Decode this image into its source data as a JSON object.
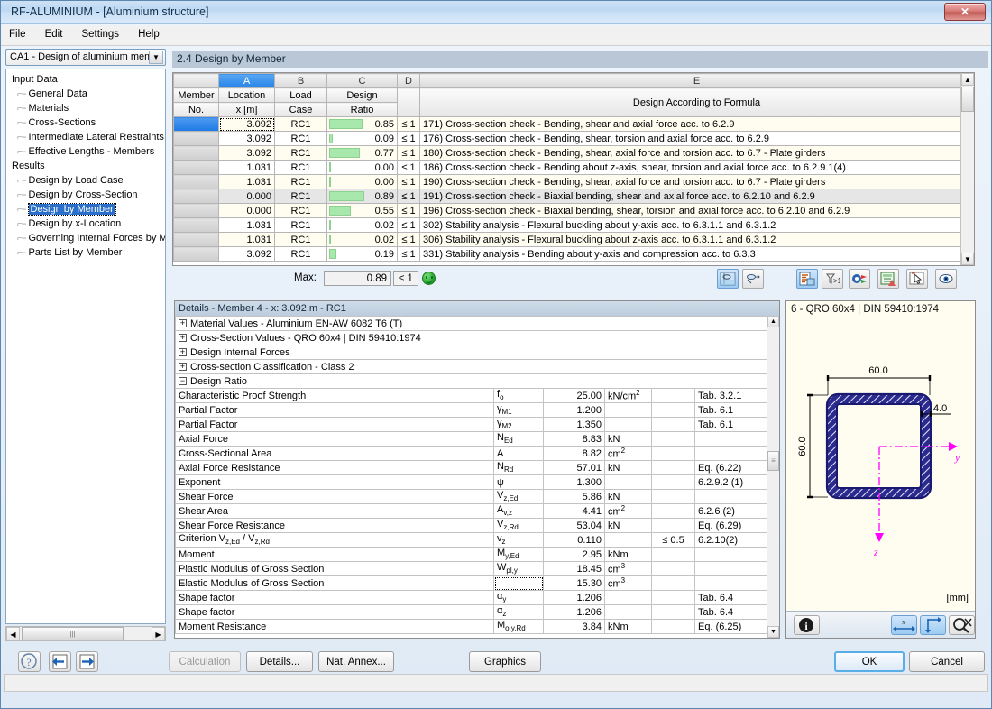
{
  "window": {
    "title": "RF-ALUMINIUM - [Aluminium structure]",
    "close_label": "✕"
  },
  "menu": {
    "items": [
      "File",
      "Edit",
      "Settings",
      "Help"
    ]
  },
  "sidebar": {
    "combo_value": "CA1 - Design of aluminium meml",
    "combo_arrow": "▼",
    "groups": [
      {
        "label": "Input Data",
        "items": [
          "General Data",
          "Materials",
          "Cross-Sections",
          "Intermediate Lateral Restraints",
          "Effective Lengths - Members"
        ]
      },
      {
        "label": "Results",
        "items": [
          "Design by Load Case",
          "Design by Cross-Section",
          "Design by Member",
          "Design by x-Location",
          "Governing Internal Forces by M",
          "Parts List by Member"
        ]
      }
    ],
    "selected": "Design by Member",
    "scroll": {
      "left_arrow": "◀",
      "right_arrow": "▶",
      "grip": "|||"
    }
  },
  "main": {
    "tab_title": "2.4 Design by Member",
    "grid": {
      "column_letters": [
        "A",
        "B",
        "C",
        "D",
        "E"
      ],
      "active_letter": "A",
      "headers": {
        "member": [
          "Member",
          "No."
        ],
        "location": [
          "Location",
          "x [m]"
        ],
        "loadcase": [
          "Load",
          "Case"
        ],
        "ratio": [
          "Design",
          "Ratio"
        ],
        "limit": "",
        "formula": "Design According to Formula"
      },
      "rows": [
        {
          "member": "",
          "location": "3.092",
          "load_case": "RC1",
          "ratio": "0.85",
          "bar": 0.85,
          "limit": "≤ 1",
          "formula": "171) Cross-section check - Bending, shear and axial force acc. to 6.2.9"
        },
        {
          "member": "",
          "location": "3.092",
          "load_case": "RC1",
          "ratio": "0.09",
          "bar": 0.09,
          "limit": "≤ 1",
          "formula": "176) Cross-section check - Bending, shear, torsion and axial force acc. to 6.2.9"
        },
        {
          "member": "",
          "location": "3.092",
          "load_case": "RC1",
          "ratio": "0.77",
          "bar": 0.77,
          "limit": "≤ 1",
          "formula": "180) Cross-section check - Bending, shear, axial force and torsion acc. to 6.7 - Plate girders"
        },
        {
          "member": "",
          "location": "1.031",
          "load_case": "RC1",
          "ratio": "0.00",
          "bar": 0.0,
          "limit": "≤ 1",
          "formula": "186) Cross-section check - Bending about z-axis, shear, torsion and axial force acc. to 6.2.9.1(4)"
        },
        {
          "member": "",
          "location": "1.031",
          "load_case": "RC1",
          "ratio": "0.00",
          "bar": 0.0,
          "limit": "≤ 1",
          "formula": "190) Cross-section check - Bending, shear, axial force and torsion acc. to 6.7 - Plate girders"
        },
        {
          "member": "",
          "location": "0.000",
          "load_case": "RC1",
          "ratio": "0.89",
          "bar": 0.89,
          "limit": "≤ 1",
          "formula": "191) Cross-section check - Biaxial bending, shear and axial force acc. to 6.2.10 and 6.2.9"
        },
        {
          "member": "",
          "location": "0.000",
          "load_case": "RC1",
          "ratio": "0.55",
          "bar": 0.55,
          "limit": "≤ 1",
          "formula": "196) Cross-section check - Biaxial bending, shear, torsion and axial force acc. to 6.2.10 and 6.2.9"
        },
        {
          "member": "",
          "location": "1.031",
          "load_case": "RC1",
          "ratio": "0.02",
          "bar": 0.02,
          "limit": "≤ 1",
          "formula": "302) Stability analysis - Flexural buckling about y-axis acc. to 6.3.1.1 and 6.3.1.2"
        },
        {
          "member": "",
          "location": "1.031",
          "load_case": "RC1",
          "ratio": "0.02",
          "bar": 0.02,
          "limit": "≤ 1",
          "formula": "306) Stability analysis - Flexural buckling about z-axis acc. to 6.3.1.1 and 6.3.1.2"
        },
        {
          "member": "",
          "location": "3.092",
          "load_case": "RC1",
          "ratio": "0.19",
          "bar": 0.19,
          "limit": "≤ 1",
          "formula": "331) Stability analysis - Bending about y-axis and compression acc. to 6.3.3"
        }
      ],
      "highlighted_row_index": 5,
      "selected_row_index": 0,
      "scroll": {
        "up": "▲",
        "down": "▼"
      }
    },
    "max": {
      "label": "Max:",
      "value": "0.89",
      "limit": "≤ 1",
      "status": "pass"
    },
    "toolbar": [
      {
        "name": "result-values-icon",
        "active": true
      },
      {
        "name": "result-diagram-icon",
        "active": false
      },
      {
        "name": "filter-list-icon",
        "active": true
      },
      {
        "name": "filter-greater-one-icon",
        "active": false
      },
      {
        "name": "color-render-icon",
        "active": false
      },
      {
        "name": "export-excel-icon",
        "active": false
      },
      {
        "name": "select-pointer-icon",
        "active": false
      },
      {
        "name": "view-eye-icon",
        "active": false
      }
    ]
  },
  "details": {
    "header": "Details - Member 4 - x: 3.092 m - RC1",
    "groups": [
      {
        "expander": "+",
        "label": "Material Values - Aluminium EN-AW 6082 T6 (T)"
      },
      {
        "expander": "+",
        "label": "Cross-Section Values  -  QRO 60x4 | DIN 59410:1974"
      },
      {
        "expander": "+",
        "label": "Design Internal Forces"
      },
      {
        "expander": "+",
        "label": "Cross-section Classification - Class 2"
      },
      {
        "expander": "−",
        "label": "Design Ratio"
      }
    ],
    "rows": [
      {
        "label": "Characteristic Proof Strength",
        "sym": "f",
        "sub": "o",
        "value": "25.00",
        "unit": "kN/cm",
        "unit_sup": "2",
        "limit": "",
        "ref": "Tab. 3.2.1"
      },
      {
        "label": "Partial Factor",
        "sym": "γ",
        "sub": "M1",
        "value": "1.200",
        "unit": "",
        "unit_sup": "",
        "limit": "",
        "ref": "Tab. 6.1"
      },
      {
        "label": "Partial Factor",
        "sym": "γ",
        "sub": "M2",
        "value": "1.350",
        "unit": "",
        "unit_sup": "",
        "limit": "",
        "ref": "Tab. 6.1"
      },
      {
        "label": "Axial Force",
        "sym": "N",
        "sub": "Ed",
        "value": "8.83",
        "unit": "kN",
        "unit_sup": "",
        "limit": "",
        "ref": ""
      },
      {
        "label": "Cross-Sectional Area",
        "sym": "A",
        "sub": "",
        "value": "8.82",
        "unit": "cm",
        "unit_sup": "2",
        "limit": "",
        "ref": ""
      },
      {
        "label": "Axial Force Resistance",
        "sym": "N",
        "sub": "Rd",
        "value": "57.01",
        "unit": "kN",
        "unit_sup": "",
        "limit": "",
        "ref": "Eq. (6.22)"
      },
      {
        "label": "Exponent",
        "sym": "ψ",
        "sub": "",
        "value": "1.300",
        "unit": "",
        "unit_sup": "",
        "limit": "",
        "ref": "6.2.9.2 (1)"
      },
      {
        "label": "Shear Force",
        "sym": "V",
        "sub": "z,Ed",
        "value": "5.86",
        "unit": "kN",
        "unit_sup": "",
        "limit": "",
        "ref": ""
      },
      {
        "label": "Shear Area",
        "sym": "A",
        "sub": "v,z",
        "value": "4.41",
        "unit": "cm",
        "unit_sup": "2",
        "limit": "",
        "ref": "6.2.6 (2)"
      },
      {
        "label": "Shear Force Resistance",
        "sym": "V",
        "sub": "z,Rd",
        "value": "53.04",
        "unit": "kN",
        "unit_sup": "",
        "limit": "",
        "ref": "Eq. (6.29)"
      },
      {
        "label": "Criterion V_z,Ed / V_z,Rd",
        "sym": "v",
        "sub": "z",
        "value": "0.110",
        "unit": "",
        "unit_sup": "",
        "limit": "≤ 0.5",
        "ref": "6.2.10(2)"
      },
      {
        "label": "Moment",
        "sym": "M",
        "sub": "y,Ed",
        "value": "2.95",
        "unit": "kNm",
        "unit_sup": "",
        "limit": "",
        "ref": ""
      },
      {
        "label": "Plastic Modulus of Gross Section",
        "sym": "W",
        "sub": "pl,y",
        "value": "18.45",
        "unit": "cm",
        "unit_sup": "3",
        "limit": "",
        "ref": ""
      },
      {
        "label": "Elastic Modulus of Gross Section",
        "sym": "",
        "sub": "",
        "value": "15.30",
        "unit": "cm",
        "unit_sup": "3",
        "limit": "",
        "ref": "",
        "focused": true
      },
      {
        "label": "Shape factor",
        "sym": "α",
        "sub": "y",
        "value": "1.206",
        "unit": "",
        "unit_sup": "",
        "limit": "",
        "ref": "Tab. 6.4"
      },
      {
        "label": "Shape factor",
        "sym": "α",
        "sub": "z",
        "value": "1.206",
        "unit": "",
        "unit_sup": "",
        "limit": "",
        "ref": "Tab. 6.4"
      },
      {
        "label": "Moment Resistance",
        "sym": "M",
        "sub": "o,y,Rd",
        "value": "3.84",
        "unit": "kNm",
        "unit_sup": "",
        "limit": "",
        "ref": "Eq. (6.25)"
      }
    ],
    "criterion_row_label": {
      "prefix": "Criterion V",
      "sub1": "z,Ed",
      "mid": " / V",
      "sub2": "z,Rd"
    },
    "scroll": {
      "up": "▲",
      "down": "▼",
      "grip": "≡"
    }
  },
  "cross_section": {
    "title": "6 - QRO 60x4 | DIN 59410:1974",
    "width_dim": "60.0",
    "height_dim": "60.0",
    "thickness_dim": "4.0",
    "axis_y": "y",
    "axis_z": "z",
    "unit": "[mm]",
    "colors": {
      "outline": "#191970",
      "axis": "#ff00ff",
      "background": "#fffdf0"
    },
    "buttons": [
      {
        "name": "info-icon",
        "active": false
      },
      {
        "name": "dimension-x-icon",
        "active": true
      },
      {
        "name": "dimension-y-icon",
        "active": true
      },
      {
        "name": "zoom-reset-icon",
        "active": false
      }
    ]
  },
  "bottom": {
    "help_icon": "?",
    "prev_icon": "◄",
    "next_icon": "►",
    "calculation_label": "Calculation",
    "details_label": "Details...",
    "nat_annex_label": "Nat. Annex...",
    "graphics_label": "Graphics",
    "ok_label": "OK",
    "cancel_label": "Cancel"
  }
}
